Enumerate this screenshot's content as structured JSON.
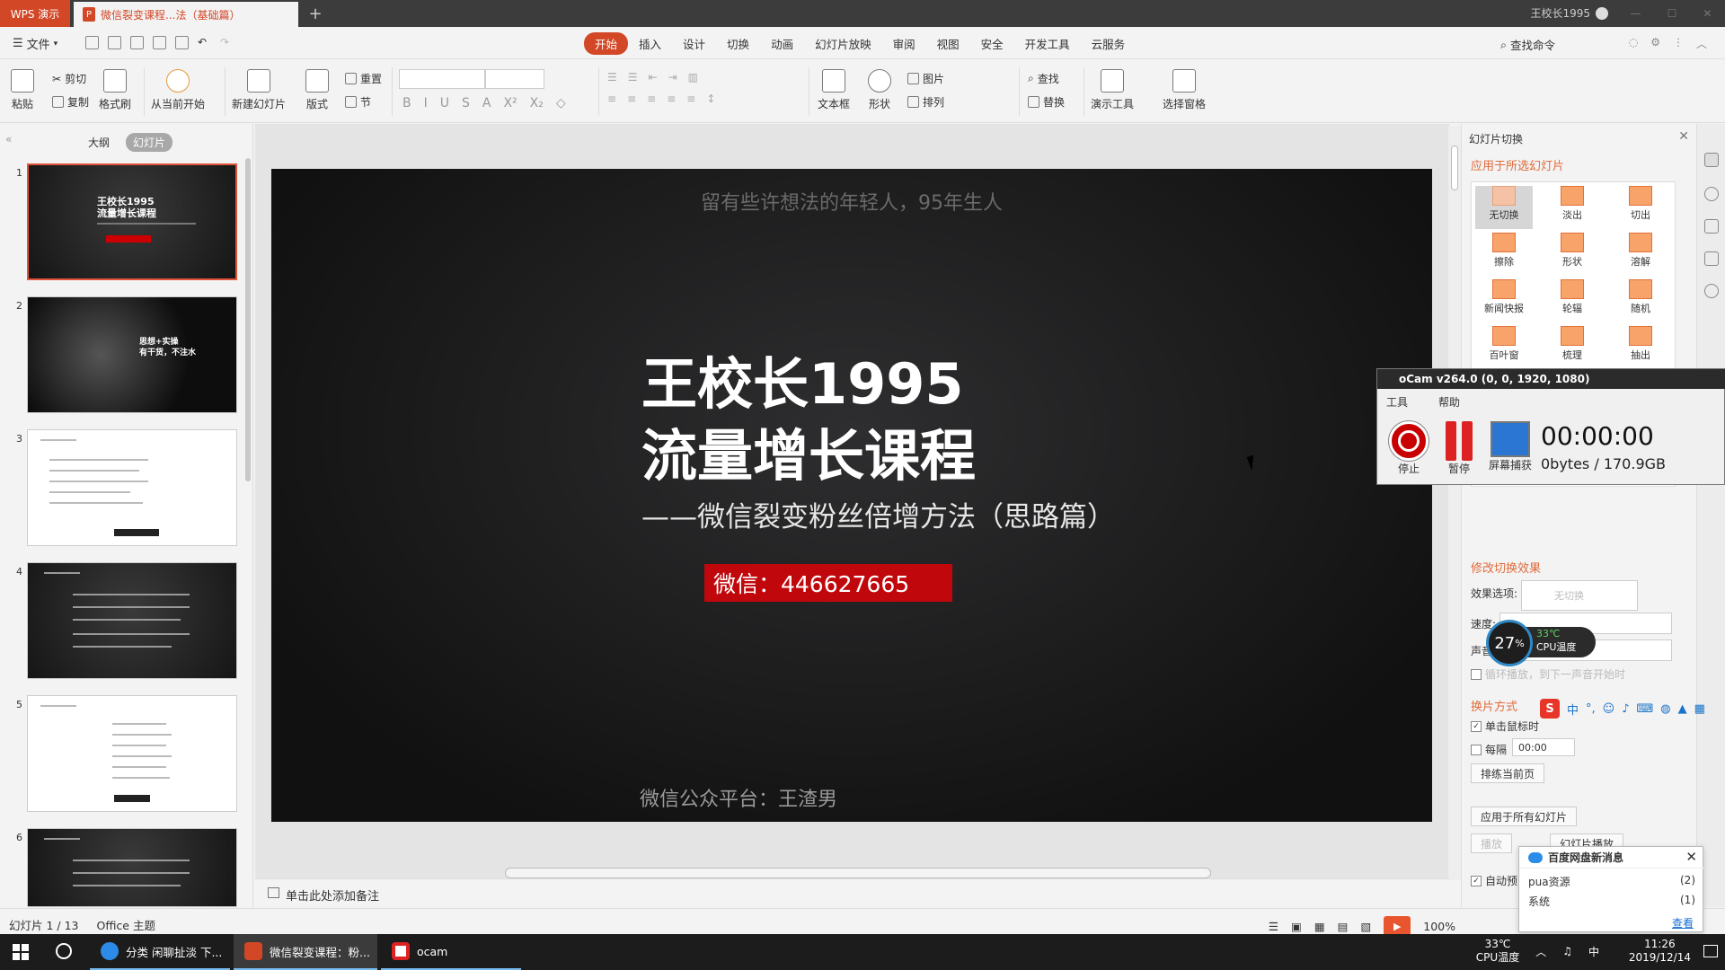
{
  "titlebar": {
    "app_tab": "WPS 演示",
    "doc_tab": "微信裂变课程...法（基础篇）",
    "doc_icon": "P",
    "new_tab": "+",
    "user": "王校长1995"
  },
  "menubar": {
    "file": "文件",
    "tabs": [
      "开始",
      "插入",
      "设计",
      "切换",
      "动画",
      "幻灯片放映",
      "审阅",
      "视图",
      "安全",
      "开发工具",
      "云服务"
    ],
    "search_cmd": "查找命令"
  },
  "ribbon": {
    "paste": "粘贴",
    "cut": "剪切",
    "copy": "复制",
    "format_painter": "格式刷",
    "from_current": "从当前开始",
    "new_slide": "新建幻灯片",
    "layout": "版式",
    "reset": "重置",
    "section": "节",
    "textbox": "文本框",
    "shape": "形状",
    "picture": "图片",
    "arrange": "排列",
    "find": "查找",
    "replace": "替换",
    "present_tools": "演示工具",
    "selection_pane": "选择窗格",
    "format_glyphs": [
      "B",
      "I",
      "U",
      "S",
      "A",
      "X²",
      "X₂",
      "◇"
    ]
  },
  "left_panel": {
    "tab_outline": "大纲",
    "tab_slides": "幻灯片",
    "collapse": "«",
    "thumb1_text": "王校长1995\n流量增长课程",
    "thumb2_text": "思想+实操\n有干货，不注水",
    "slides": [
      1,
      2,
      3,
      4,
      5,
      6
    ]
  },
  "slide": {
    "top_line": "留有些许想法的年轻人，95年生人",
    "title_line1": "王校长1995",
    "title_line2": "流量增长课程",
    "subtitle": "——微信裂变粉丝倍增方法（思路篇）",
    "wechat": "微信：446627665",
    "footer": "微信公众平台：王渣男"
  },
  "notes": {
    "placeholder": "单击此处添加备注"
  },
  "right_panel": {
    "header": "幻灯片切换",
    "apply_selected": "应用于所选幻灯片",
    "transitions": [
      "无切换",
      "淡出",
      "切出",
      "擦除",
      "形状",
      "溶解",
      "新闻快报",
      "轮辐",
      "随机",
      "百叶窗",
      "梳理",
      "抽出"
    ],
    "modify": "修改切换效果",
    "effect_label": "效果选项:",
    "effect_value": "无切换",
    "speed_label": "速度:",
    "sound_label": "声音",
    "loop_label": "循环播放，到下一声音开始时",
    "advance_label": "换片方式",
    "on_click": "单击鼠标时",
    "every": "每隔",
    "every_value": "00:00",
    "rehearse": "排练当前页",
    "apply_all": "应用于所有幻灯片",
    "play": "播放",
    "slideshow": "幻灯片播放",
    "auto_preview": "自动预"
  },
  "ocam": {
    "title": "oCam v264.0 (0, 0, 1920, 1080)",
    "menu": [
      "工具",
      "帮助"
    ],
    "stop": "停止",
    "pause": "暂停",
    "capture": "屏幕捕获",
    "time": "00:00:00",
    "size": "0bytes / 170.9GB"
  },
  "cpu": {
    "percent": "27",
    "percent_unit": "%",
    "temp": "33℃",
    "temp_label": "CPU温度"
  },
  "ime": {
    "logo": "S",
    "mode": "中"
  },
  "baidu": {
    "title": "百度网盘新消息",
    "rows": [
      {
        "name": "pua资源",
        "count": "(2)"
      },
      {
        "name": "系统",
        "count": "(1)"
      }
    ],
    "view": "查看"
  },
  "status": {
    "slide_pos": "幻灯片 1 / 13",
    "theme": "Office 主题",
    "zoom": "100%"
  },
  "taskbar": {
    "apps": [
      "分类 闲聊扯淡 下...",
      "微信裂变课程：粉...",
      "ocam"
    ],
    "temp": "33℃",
    "temp_label": "CPU温度",
    "ime": "中",
    "time": "11:26",
    "date": "2019/12/14"
  },
  "colors": {
    "accent": "#d24726",
    "slide_red": "#c0080c",
    "panel_orange": "#e06b3a"
  }
}
